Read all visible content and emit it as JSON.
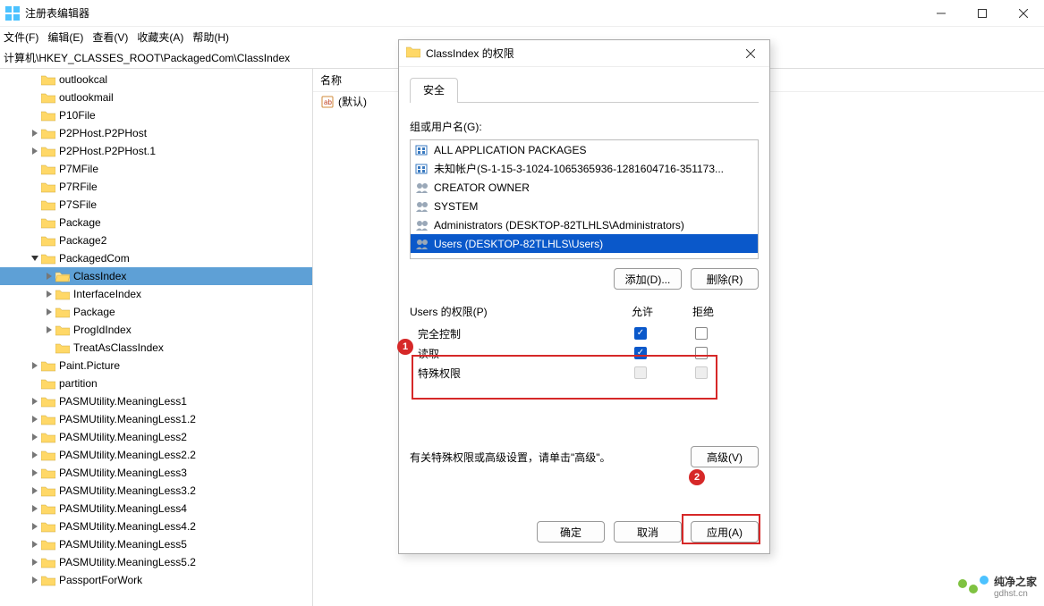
{
  "window": {
    "title": "注册表编辑器"
  },
  "menu": {
    "file": "文件(F)",
    "edit": "编辑(E)",
    "view": "查看(V)",
    "favorites": "收藏夹(A)",
    "help": "帮助(H)"
  },
  "path": "计算机\\HKEY_CLASSES_ROOT\\PackagedCom\\ClassIndex",
  "tree": [
    {
      "label": "outlookcal",
      "indent": 2,
      "expander": ""
    },
    {
      "label": "outlookmail",
      "indent": 2,
      "expander": ""
    },
    {
      "label": "P10File",
      "indent": 2,
      "expander": ""
    },
    {
      "label": "P2PHost.P2PHost",
      "indent": 2,
      "expander": ">"
    },
    {
      "label": "P2PHost.P2PHost.1",
      "indent": 2,
      "expander": ">"
    },
    {
      "label": "P7MFile",
      "indent": 2,
      "expander": ""
    },
    {
      "label": "P7RFile",
      "indent": 2,
      "expander": ""
    },
    {
      "label": "P7SFile",
      "indent": 2,
      "expander": ""
    },
    {
      "label": "Package",
      "indent": 2,
      "expander": ""
    },
    {
      "label": "Package2",
      "indent": 2,
      "expander": ""
    },
    {
      "label": "PackagedCom",
      "indent": 2,
      "expander": "v"
    },
    {
      "label": "ClassIndex",
      "indent": 3,
      "expander": ">",
      "selected": true,
      "open": true
    },
    {
      "label": "InterfaceIndex",
      "indent": 3,
      "expander": ">"
    },
    {
      "label": "Package",
      "indent": 3,
      "expander": ">"
    },
    {
      "label": "ProgIdIndex",
      "indent": 3,
      "expander": ">"
    },
    {
      "label": "TreatAsClassIndex",
      "indent": 3,
      "expander": ""
    },
    {
      "label": "Paint.Picture",
      "indent": 2,
      "expander": ">"
    },
    {
      "label": "partition",
      "indent": 2,
      "expander": ""
    },
    {
      "label": "PASMUtility.MeaningLess1",
      "indent": 2,
      "expander": ">"
    },
    {
      "label": "PASMUtility.MeaningLess1.2",
      "indent": 2,
      "expander": ">"
    },
    {
      "label": "PASMUtility.MeaningLess2",
      "indent": 2,
      "expander": ">"
    },
    {
      "label": "PASMUtility.MeaningLess2.2",
      "indent": 2,
      "expander": ">"
    },
    {
      "label": "PASMUtility.MeaningLess3",
      "indent": 2,
      "expander": ">"
    },
    {
      "label": "PASMUtility.MeaningLess3.2",
      "indent": 2,
      "expander": ">"
    },
    {
      "label": "PASMUtility.MeaningLess4",
      "indent": 2,
      "expander": ">"
    },
    {
      "label": "PASMUtility.MeaningLess4.2",
      "indent": 2,
      "expander": ">"
    },
    {
      "label": "PASMUtility.MeaningLess5",
      "indent": 2,
      "expander": ">"
    },
    {
      "label": "PASMUtility.MeaningLess5.2",
      "indent": 2,
      "expander": ">"
    },
    {
      "label": "PassportForWork",
      "indent": 2,
      "expander": ">"
    }
  ],
  "values": {
    "header_name": "名称",
    "rows": [
      {
        "name": "(默认)"
      }
    ]
  },
  "dialog": {
    "title": "ClassIndex 的权限",
    "tab_security": "安全",
    "group_users_label": "组或用户名(G):",
    "users": [
      {
        "name": "ALL APPLICATION PACKAGES",
        "icon": "pkg"
      },
      {
        "name": "未知帐户(S-1-15-3-1024-1065365936-1281604716-351173...",
        "icon": "pkg"
      },
      {
        "name": "CREATOR OWNER",
        "icon": "grp"
      },
      {
        "name": "SYSTEM",
        "icon": "grp"
      },
      {
        "name": "Administrators (DESKTOP-82TLHLS\\Administrators)",
        "icon": "grp"
      },
      {
        "name": "Users (DESKTOP-82TLHLS\\Users)",
        "icon": "grp",
        "selected": true
      }
    ],
    "btn_add": "添加(D)...",
    "btn_remove": "删除(R)",
    "perm_title": "Users 的权限(P)",
    "col_allow": "允许",
    "col_deny": "拒绝",
    "perms": [
      {
        "name": "完全控制",
        "allow": true,
        "deny": false
      },
      {
        "name": "读取",
        "allow": true,
        "deny": false
      },
      {
        "name": "特殊权限",
        "allow": false,
        "deny": false,
        "disabled": true
      }
    ],
    "special_text": "有关特殊权限或高级设置，请单击\"高级\"。",
    "btn_advanced": "高级(V)",
    "btn_ok": "确定",
    "btn_cancel": "取消",
    "btn_apply": "应用(A)",
    "annotation1": "1",
    "annotation2": "2"
  },
  "watermark": {
    "line1": "纯净之家",
    "line2": "gdhst.cn"
  }
}
